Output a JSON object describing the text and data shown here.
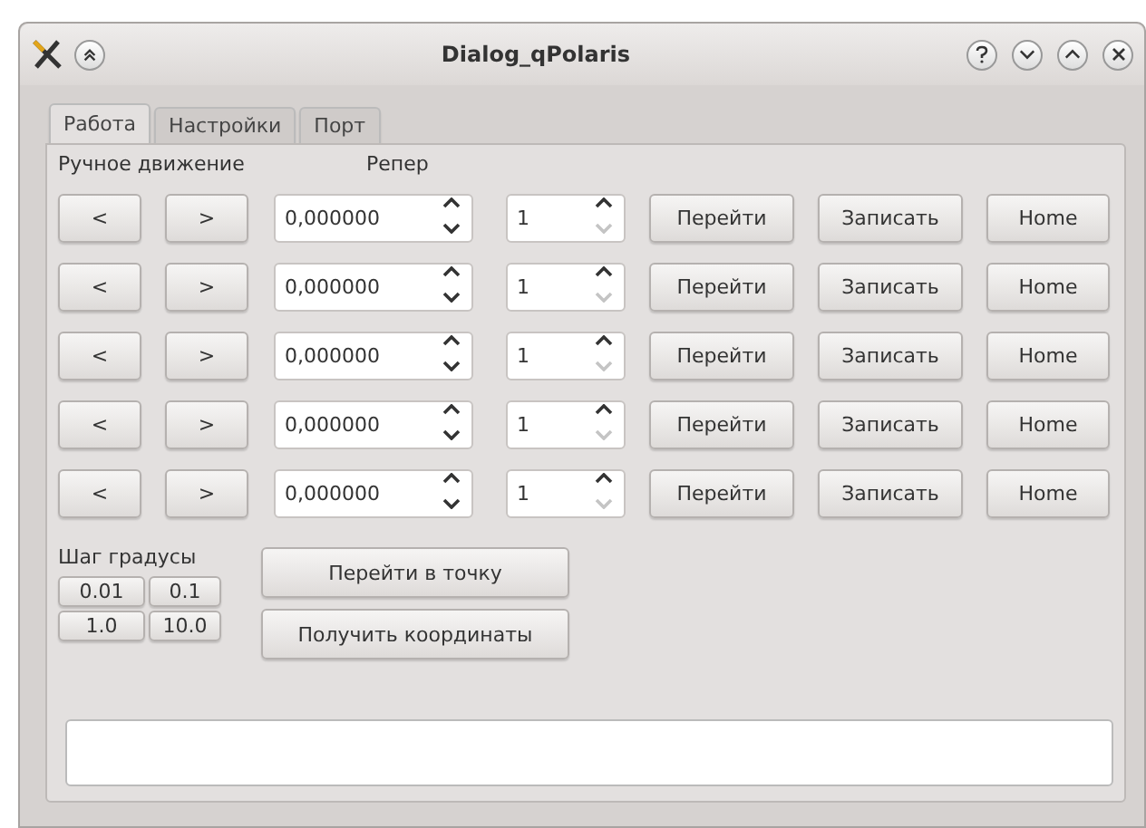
{
  "window": {
    "title": "Dialog_qPolaris"
  },
  "tabs": [
    {
      "label": "Работа",
      "selected": true
    },
    {
      "label": "Настройки",
      "selected": false
    },
    {
      "label": "Порт",
      "selected": false
    }
  ],
  "headers": {
    "manual": "Ручное движение",
    "reference": "Репер"
  },
  "rows": [
    {
      "left": "<",
      "right": ">",
      "value": "0,000000",
      "value_down_disabled": false,
      "reference": "1",
      "reference_down_disabled": true,
      "go": "Перейти",
      "save": "Записать",
      "home": "Home"
    },
    {
      "left": "<",
      "right": ">",
      "value": "0,000000",
      "value_down_disabled": false,
      "reference": "1",
      "reference_down_disabled": true,
      "go": "Перейти",
      "save": "Записать",
      "home": "Home"
    },
    {
      "left": "<",
      "right": ">",
      "value": "0,000000",
      "value_down_disabled": false,
      "reference": "1",
      "reference_down_disabled": true,
      "go": "Перейти",
      "save": "Записать",
      "home": "Home"
    },
    {
      "left": "<",
      "right": ">",
      "value": "0,000000",
      "value_down_disabled": false,
      "reference": "1",
      "reference_down_disabled": true,
      "go": "Перейти",
      "save": "Записать",
      "home": "Home"
    },
    {
      "left": "<",
      "right": ">",
      "value": "0,000000",
      "value_down_disabled": false,
      "reference": "1",
      "reference_down_disabled": true,
      "go": "Перейти",
      "save": "Записать",
      "home": "Home"
    }
  ],
  "step": {
    "label": "Шаг градусы",
    "buttons": [
      "0.01",
      "0.1",
      "1.0",
      "10.0"
    ]
  },
  "actions": [
    "Перейти в точку",
    "Получить координаты"
  ]
}
